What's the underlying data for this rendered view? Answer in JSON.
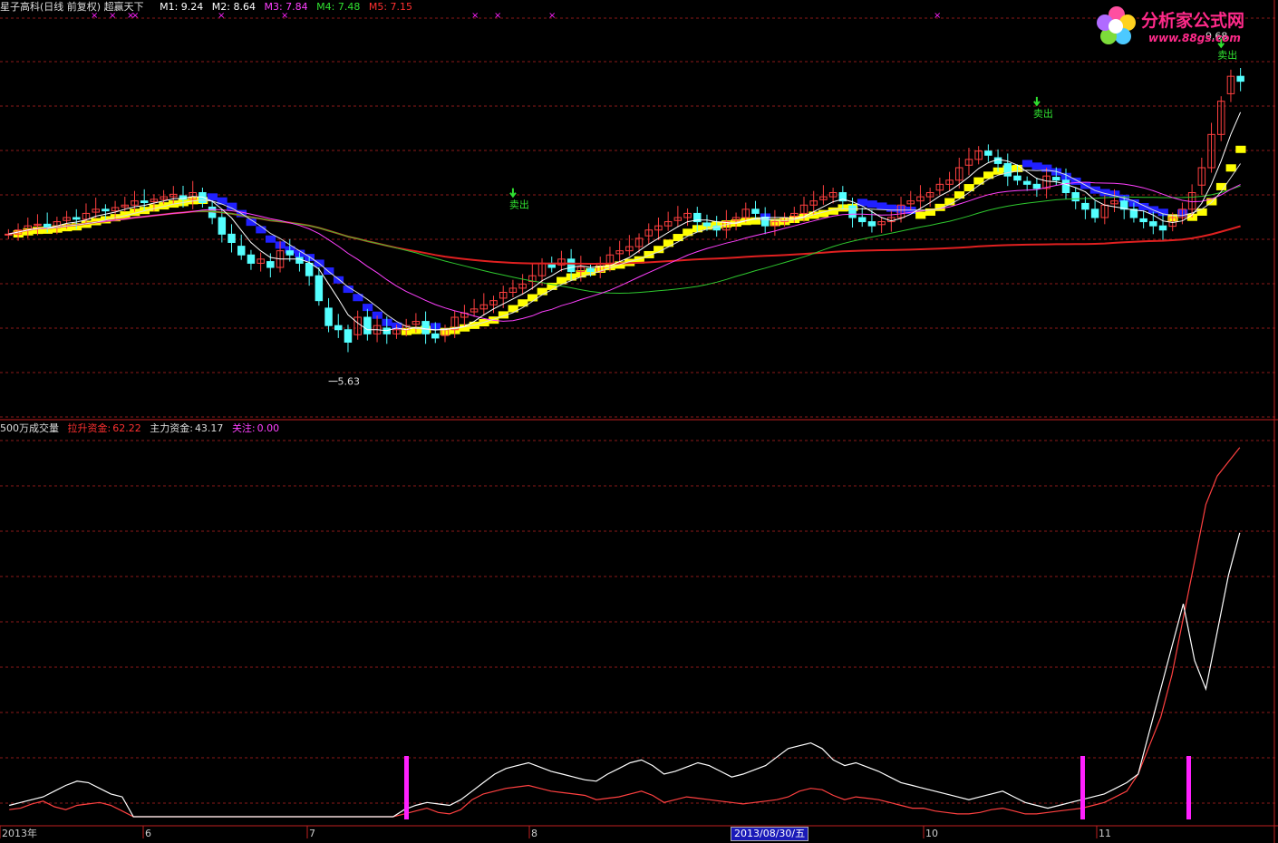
{
  "colors": {
    "background": "#000000",
    "grid": "#8b1a1a",
    "up": "#ff4040",
    "down": "#54ffff",
    "ma_white": "#ffffff",
    "ma_magenta": "#ff40ff",
    "ma_green": "#2ec82e",
    "ma_red": "#e02020",
    "yellow_band": "#ffff00",
    "blue_band": "#2020ff",
    "flag": "#ff20ff",
    "sell": "#30e030"
  },
  "header": {
    "title": "星子高科(日线 前复权) 超赢天下",
    "m1": "M1: 9.24",
    "m2": "M2: 8.64",
    "m3": "M3: 7.84",
    "m4": "M4: 7.48",
    "m5": "M5: 7.15"
  },
  "logo": {
    "text": "分析家公式网",
    "url": "www.88gs.com"
  },
  "sub_header": {
    "name": "500万成交量",
    "pull_label": "拉升资金:",
    "pull_value": "62.22",
    "main_label": "主力资金:",
    "main_value": "43.17",
    "watch_label": "关注:",
    "watch_value": "0.00"
  },
  "annotations": {
    "high": "9.68",
    "low": "5.63",
    "sell": "卖出"
  },
  "x_axis": {
    "labels": [
      "2013年",
      "6",
      "7",
      "8",
      "10",
      "11"
    ],
    "cursor_date": "2013/08/30/五"
  },
  "chart_data": [
    {
      "type": "candlestick",
      "title": "星子高科(日线 前复权) 超赢天下",
      "ylim": [
        5.2,
        10.0
      ],
      "close": [
        7.4,
        7.45,
        7.5,
        7.52,
        7.48,
        7.55,
        7.6,
        7.58,
        7.65,
        7.7,
        7.68,
        7.72,
        7.75,
        7.8,
        7.78,
        7.82,
        7.85,
        7.88,
        7.82,
        7.9,
        7.78,
        7.6,
        7.4,
        7.3,
        7.15,
        7.05,
        7.1,
        7.0,
        7.2,
        7.15,
        7.05,
        6.9,
        6.6,
        6.3,
        6.25,
        6.1,
        6.4,
        6.2,
        6.3,
        6.2,
        6.25,
        6.3,
        6.35,
        6.2,
        6.15,
        6.25,
        6.4,
        6.45,
        6.5,
        6.55,
        6.6,
        6.7,
        6.75,
        6.8,
        6.9,
        7.05,
        7.0,
        7.1,
        6.95,
        7.0,
        6.95,
        7.05,
        7.15,
        7.2,
        7.25,
        7.35,
        7.45,
        7.5,
        7.55,
        7.6,
        7.65,
        7.55,
        7.5,
        7.45,
        7.55,
        7.6,
        7.7,
        7.65,
        7.5,
        7.55,
        7.6,
        7.65,
        7.75,
        7.8,
        7.85,
        7.9,
        7.8,
        7.6,
        7.55,
        7.5,
        7.55,
        7.6,
        7.75,
        7.8,
        7.85,
        7.9,
        8.0,
        8.05,
        8.2,
        8.3,
        8.4,
        8.35,
        8.25,
        8.1,
        8.05,
        8.0,
        7.95,
        8.1,
        8.05,
        7.9,
        7.8,
        7.7,
        7.6,
        7.75,
        7.8,
        7.7,
        7.6,
        7.55,
        7.5,
        7.45,
        7.6,
        7.7,
        7.9,
        8.2,
        8.6,
        9.0,
        9.3,
        9.24
      ],
      "ma": [
        {
          "name": "M1",
          "values_end": 9.24
        },
        {
          "name": "M2",
          "values_end": 8.64
        },
        {
          "name": "M3",
          "values_end": 7.84
        },
        {
          "name": "M4",
          "values_end": 7.48
        },
        {
          "name": "M5",
          "values_end": 7.15
        }
      ],
      "annotations": [
        {
          "text": "9.68",
          "type": "high"
        },
        {
          "text": "5.63",
          "type": "low"
        },
        {
          "text": "卖出",
          "count": 3
        }
      ]
    },
    {
      "type": "line",
      "title": "500万成交量",
      "series": [
        {
          "name": "拉升资金",
          "last": 62.22,
          "values": [
            5,
            6,
            9,
            11,
            7,
            5,
            8,
            9,
            10,
            8,
            4,
            0,
            0,
            0,
            0,
            0,
            0,
            0,
            0,
            0,
            0,
            0,
            0,
            0,
            0,
            0,
            0,
            0,
            0,
            0,
            0,
            0,
            0,
            0,
            0,
            2,
            4,
            6,
            3,
            2,
            5,
            12,
            16,
            18,
            20,
            21,
            22,
            20,
            18,
            17,
            16,
            15,
            12,
            13,
            14,
            16,
            18,
            15,
            10,
            12,
            14,
            13,
            12,
            11,
            10,
            9,
            10,
            11,
            12,
            14,
            18,
            20,
            19,
            15,
            12,
            14,
            13,
            12,
            10,
            8,
            6,
            6,
            4,
            3,
            2,
            2,
            3,
            5,
            6,
            4,
            2,
            2,
            3,
            4,
            5,
            6,
            8,
            10,
            14,
            18,
            30,
            50,
            70,
            100,
            140,
            180,
            220,
            240,
            250,
            260
          ]
        },
        {
          "name": "主力资金",
          "last": 43.17,
          "values": [
            8,
            10,
            12,
            14,
            18,
            22,
            25,
            24,
            20,
            16,
            14,
            0,
            0,
            0,
            0,
            0,
            0,
            0,
            0,
            0,
            0,
            0,
            0,
            0,
            0,
            0,
            0,
            0,
            0,
            0,
            0,
            0,
            0,
            0,
            0,
            5,
            8,
            10,
            9,
            8,
            12,
            18,
            24,
            30,
            34,
            36,
            38,
            35,
            32,
            30,
            28,
            26,
            25,
            30,
            34,
            38,
            40,
            36,
            30,
            32,
            35,
            38,
            36,
            32,
            28,
            30,
            33,
            36,
            42,
            48,
            50,
            52,
            48,
            40,
            36,
            38,
            35,
            32,
            28,
            24,
            22,
            20,
            18,
            16,
            14,
            12,
            14,
            16,
            18,
            14,
            10,
            8,
            6,
            8,
            10,
            12,
            14,
            16,
            20,
            24,
            30,
            60,
            90,
            120,
            150,
            110,
            90,
            130,
            170,
            200
          ]
        }
      ],
      "flags": [
        {
          "label": "关注",
          "value": 0.0
        }
      ]
    }
  ]
}
